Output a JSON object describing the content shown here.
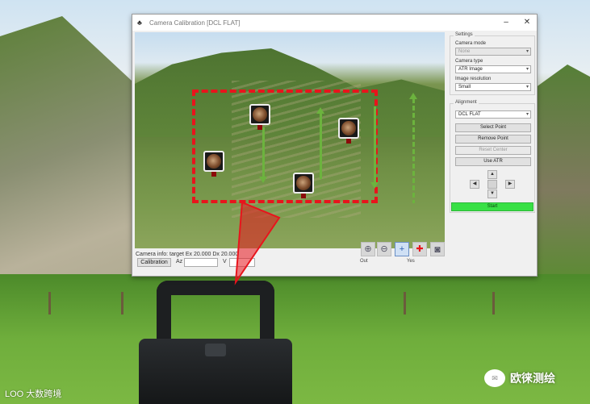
{
  "window": {
    "title": "Camera Calibration [DCL FLAT]",
    "minimize": "–",
    "close": "✕"
  },
  "status": {
    "text": "Camera info: target  Ex 20.000  Dx 20.000"
  },
  "bottom": {
    "calibrate_button": "Calibration",
    "label_a": "Az",
    "label_b": "V",
    "value_a": "",
    "value_b": ""
  },
  "tools": [
    {
      "icon": "zoom-in-icon",
      "glyph": "⊕"
    },
    {
      "icon": "zoom-out-icon",
      "glyph": "⊖"
    },
    {
      "icon": "crosshair-icon",
      "glyph": "+"
    },
    {
      "icon": "pin-icon",
      "glyph": "📍"
    },
    {
      "icon": "camera-icon",
      "glyph": "◙"
    }
  ],
  "tool_captions": {
    "left": "Out",
    "right": "Yes"
  },
  "panel": {
    "settings_title": "Settings",
    "camera_mode_label": "Camera mode",
    "camera_mode_value": "None",
    "camera_type_label": "Camera type",
    "camera_type_value": "ATR Image",
    "image_res_label": "Image resolution",
    "image_res_value": "Small",
    "alignment_title": "Alignment",
    "alignment_value": "DCL FLAT",
    "btn_select_point": "Select Point",
    "btn_remove_point": "Remove Point",
    "btn_reset_center": "Reset Center",
    "btn_use_atr": "Use ATR",
    "dpad_up": "▲",
    "dpad_down": "▼",
    "dpad_left": "◀",
    "dpad_right": "▶",
    "ok_label": "Start"
  },
  "watermarks": {
    "left": "大数跨境",
    "left_logo": "LOO",
    "right": "欧徕测绘",
    "right_icon": "✉"
  },
  "colors": {
    "selection_rect": "#e8141c",
    "arrows": "#6cb33e",
    "ok_bar": "#38e045",
    "sight_pointer": "#e8141c"
  }
}
